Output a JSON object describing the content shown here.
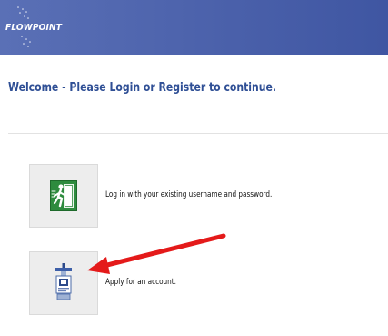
{
  "header": {
    "logo_text": "FLOWPOINT"
  },
  "main": {
    "welcome_text": "Welcome - Please Login or Register to continue.",
    "options": [
      {
        "label": "Log in with your existing username and password.",
        "icon": "exit-door-icon"
      },
      {
        "label": "Apply for an account.",
        "icon": "id-badge-icon"
      }
    ]
  },
  "colors": {
    "header_blue": "#4e64ad",
    "welcome_text": "#2f4f95",
    "login_icon_green": "#2e8b3e",
    "annotation_arrow": "#e41a1a"
  }
}
